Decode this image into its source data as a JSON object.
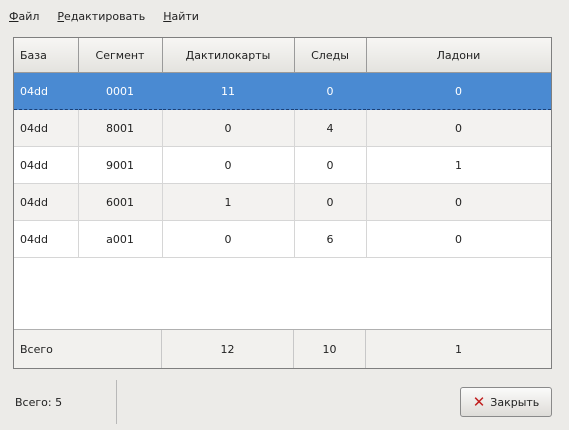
{
  "menu": [
    {
      "mnemonic": "Ф",
      "rest": "айл"
    },
    {
      "mnemonic": "Р",
      "rest": "едактировать"
    },
    {
      "mnemonic": "Н",
      "rest": "айти"
    }
  ],
  "table": {
    "columns": [
      "База",
      "Сегмент",
      "Дактилокарты",
      "Следы",
      "Ладони"
    ],
    "rows": [
      {
        "selected": true,
        "cells": [
          "04dd",
          "0001",
          "11",
          "0",
          "0"
        ]
      },
      {
        "selected": false,
        "cells": [
          "04dd",
          "8001",
          "0",
          "4",
          "0"
        ]
      },
      {
        "selected": false,
        "cells": [
          "04dd",
          "9001",
          "0",
          "0",
          "1"
        ]
      },
      {
        "selected": false,
        "cells": [
          "04dd",
          "6001",
          "1",
          "0",
          "0"
        ]
      },
      {
        "selected": false,
        "cells": [
          "04dd",
          "a001",
          "0",
          "6",
          "0"
        ]
      }
    ],
    "totals": {
      "label": "Всего",
      "values": [
        "12",
        "10",
        "1"
      ]
    }
  },
  "status": {
    "count_text": "Всего: 5"
  },
  "close_button": {
    "label": "Закрыть",
    "icon": "close-x-icon"
  },
  "colors": {
    "selection": "#4a8ad2",
    "close_icon": "#c01e1e"
  }
}
